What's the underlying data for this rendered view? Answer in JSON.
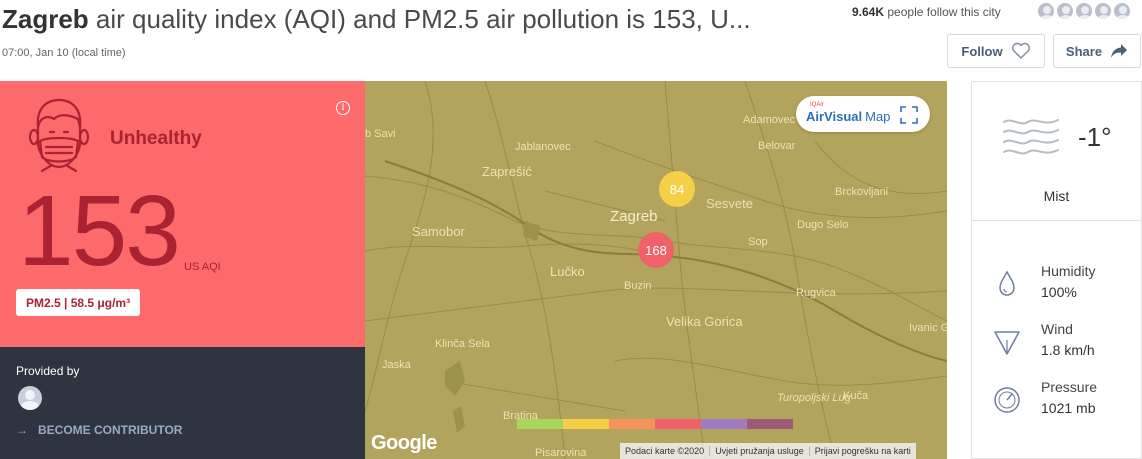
{
  "header": {
    "city": "Zagreb",
    "title_rest": " air quality index (AQI) and PM2.5 air pollution is 153, U...",
    "time": "07:00, Jan 10 (local time)",
    "followers_count": "9.64K",
    "followers_text": "people follow this city",
    "follow_label": "Follow",
    "share_label": "Share"
  },
  "aqi": {
    "status": "Unhealthy",
    "value": "153",
    "unit": "US AQI",
    "pollutant": "PM2.5 | 58.5 μg/m³",
    "bg_color": "#fd6a6b",
    "text_color": "#a92333"
  },
  "provider": {
    "label": "Provided by",
    "contribute": "BECOME CONTRIBUTOR"
  },
  "map": {
    "brand_small": "IQAir",
    "brand": "AirVisual",
    "brand_map": "Map",
    "places": [
      "b Savi",
      "Jablanovec",
      "Adamovec",
      "Belovar",
      "Zaprešić",
      "Brckovljani",
      "Zagreb",
      "Sesvete",
      "Dugo Selo",
      "Samobor",
      "Sop",
      "Lučko",
      "Buzin",
      "Rugvica",
      "Velika Gorica",
      "Ivanic G",
      "Klinča Sela",
      "Jaska",
      "Turopoljski Lug",
      "Kuča",
      "Bratina",
      "Pisarovina"
    ],
    "markers": [
      {
        "value": "84",
        "color": "#f5cf47"
      },
      {
        "value": "168",
        "color": "#f0616a"
      }
    ],
    "legend_colors": [
      "#a9d65c",
      "#f5cf47",
      "#f6935a",
      "#f0616a",
      "#a27cc2",
      "#a05b78"
    ],
    "google": "Google",
    "attribution": [
      "Podaci karte ©2020",
      "Uvjeti pružanja usluge",
      "Prijavi pogrešku na karti"
    ]
  },
  "weather": {
    "temp": "-1°",
    "condition": "Mist",
    "humidity_label": "Humidity",
    "humidity_value": "100%",
    "wind_label": "Wind",
    "wind_value": "1.8 km/h",
    "pressure_label": "Pressure",
    "pressure_value": "1021 mb"
  }
}
